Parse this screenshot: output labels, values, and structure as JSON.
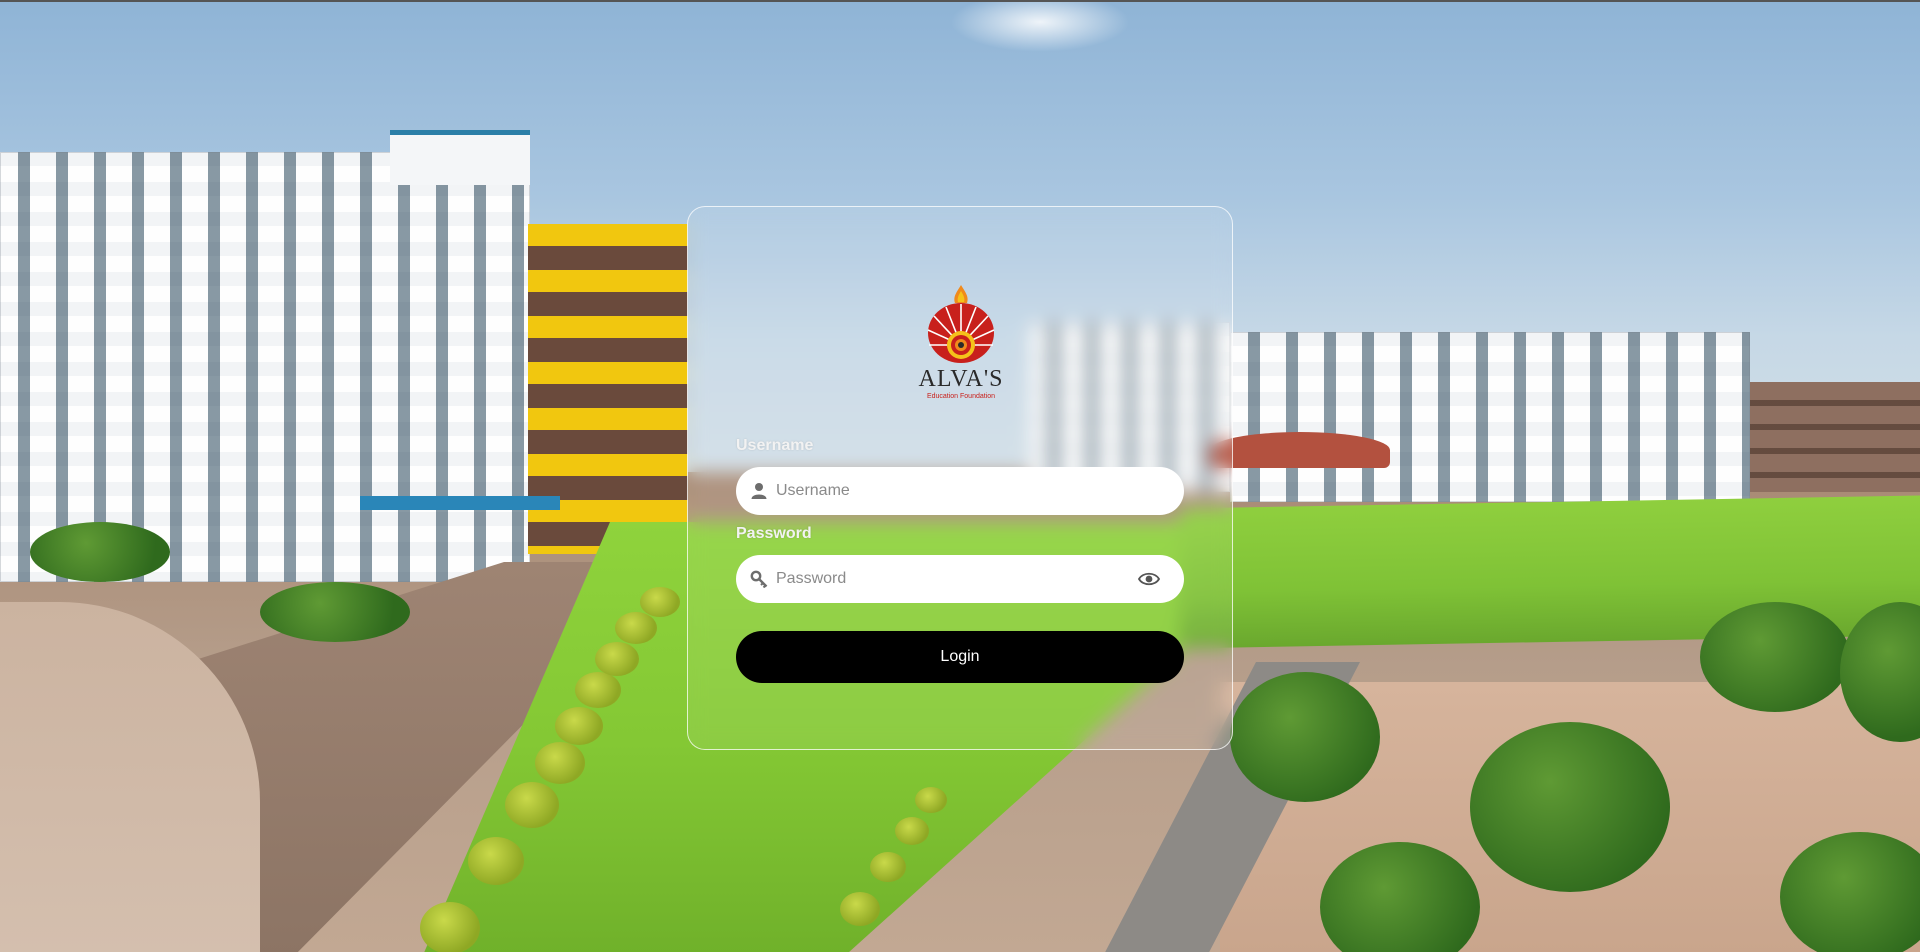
{
  "background": {
    "description_icon": "campus-photo"
  },
  "logo": {
    "wordmark": "ALVA'S",
    "tagline": "Education Foundation",
    "colors": {
      "red": "#c8201c",
      "orange": "#f08a1c",
      "yellow": "#f5c21a",
      "dark": "#2a2a2a"
    }
  },
  "form": {
    "username": {
      "label": "Username",
      "placeholder": "Username",
      "value": "",
      "icon": "user-icon"
    },
    "password": {
      "label": "Password",
      "placeholder": "Password",
      "value": "",
      "icon": "key-icon",
      "toggle_icon": "eye-icon"
    },
    "submit_label": "Login"
  },
  "colors": {
    "button_bg": "#000000",
    "button_text": "#ffffff",
    "label_text": "#f2f2f2",
    "input_bg": "#ffffff"
  }
}
